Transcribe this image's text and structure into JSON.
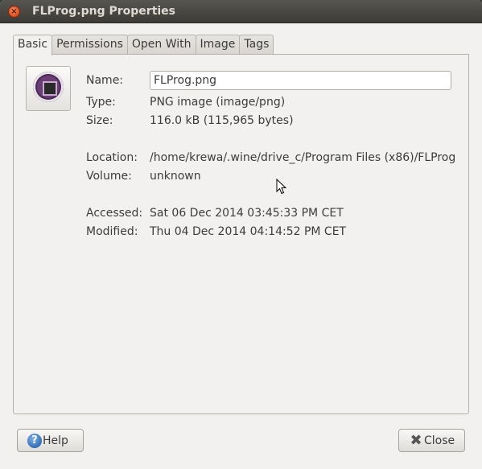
{
  "window": {
    "title": "FLProg.png Properties",
    "close_glyph": "×"
  },
  "tabs": [
    {
      "label": "Basic",
      "active": true
    },
    {
      "label": "Permissions",
      "active": false
    },
    {
      "label": "Open With",
      "active": false
    },
    {
      "label": "Image",
      "active": false
    },
    {
      "label": "Tags",
      "active": false
    }
  ],
  "basic": {
    "name_label": "Name:",
    "name_value": "FLProg.png",
    "type_label": "Type:",
    "type_value": "PNG image (image/png)",
    "size_label": "Size:",
    "size_value": "116.0 kB (115,965 bytes)",
    "location_label": "Location:",
    "location_value": "/home/krewa/.wine/drive_c/Program Files (x86)/FLProg",
    "volume_label": "Volume:",
    "volume_value": "unknown",
    "accessed_label": "Accessed:",
    "accessed_value": "Sat 06 Dec 2014 03:45:33 PM CET",
    "modified_label": "Modified:",
    "modified_value": "Thu 04 Dec 2014 04:14:52 PM CET"
  },
  "buttons": {
    "help_label": "Help",
    "help_icon": "question-icon",
    "close_label": "Close",
    "close_icon": "close-x-icon"
  },
  "colors": {
    "titlebar": "#3c3b37",
    "window_bg": "#f2f1f0",
    "close_button": "#df4a16"
  }
}
